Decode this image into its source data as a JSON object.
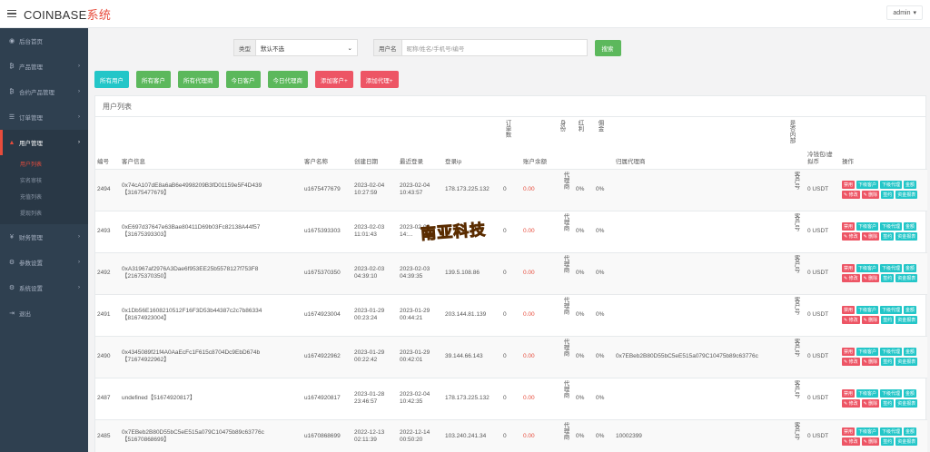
{
  "header": {
    "brand": "COINBASE",
    "brand_suffix": "系统",
    "user": "admin"
  },
  "sidebar": {
    "items": [
      {
        "label": "后台首页",
        "icon": "dashboard-icon",
        "arrow": false
      },
      {
        "label": "产品管理",
        "icon": "bitcoin-icon",
        "arrow": true
      },
      {
        "label": "合约产品管理",
        "icon": "bitcoin-icon",
        "arrow": true
      },
      {
        "label": "订单管理",
        "icon": "list-icon",
        "arrow": true
      },
      {
        "label": "用户管理",
        "icon": "user-icon",
        "arrow": true,
        "active": true
      },
      {
        "label": "财务管理",
        "icon": "yen-icon",
        "arrow": true
      },
      {
        "label": "参数设置",
        "icon": "gear-icon",
        "arrow": true
      },
      {
        "label": "系统设置",
        "icon": "gears-icon",
        "arrow": true
      },
      {
        "label": "退出",
        "icon": "logout-icon",
        "arrow": false
      }
    ],
    "subitems": [
      "用户列表",
      "实名审核",
      "充值列表",
      "提现列表"
    ]
  },
  "filter": {
    "type_label": "类型",
    "type_value": "默认不选",
    "user_label": "用户名",
    "user_placeholder": "昵称/姓名/手机号/编号",
    "search_label": "搜索"
  },
  "quick_buttons": [
    {
      "label": "所有用户",
      "color": "cyan"
    },
    {
      "label": "所有客户",
      "color": "green"
    },
    {
      "label": "所有代理商",
      "color": "green"
    },
    {
      "label": "今日客户",
      "color": "green"
    },
    {
      "label": "今日代理商",
      "color": "green"
    },
    {
      "label": "添加客户+",
      "color": "red"
    },
    {
      "label": "添加代理+",
      "color": "red"
    }
  ],
  "panel": {
    "title": "用户列表"
  },
  "table": {
    "headers": [
      "编号",
      "客户信息",
      "客户名称",
      "创建日期",
      "最近登录",
      "登录ip",
      "订单数",
      "账户余额",
      "身份",
      "红利",
      "佣金",
      "归属代理商",
      "是否内部",
      "冷钱包/虚拟币",
      "操作"
    ],
    "rows": [
      {
        "id": "2494",
        "info1": "0x74cA107dE8a6aB6e4998209B3fD01159e5F4D439",
        "info2": "【31675477679】",
        "name": "u1675477679",
        "created1": "2023-02-04",
        "created2": "10:27:59",
        "login1": "2023-02-04",
        "login2": "10:43:57",
        "ip": "178.173.225.132",
        "orders": "0",
        "balance": "0.00",
        "role": "代理商",
        "bonus": "0%",
        "commission": "0%",
        "agent": "",
        "internal": "客户号",
        "wallet": "0 USDT"
      },
      {
        "id": "2493",
        "info1": "0xE697d37647e63Bae80411D69b03Fc82138A44f57",
        "info2": "【31675393303】",
        "name": "u1675393303",
        "created1": "2023-02-03",
        "created2": "11:01:43",
        "login1": "2023-02-03",
        "login2": "14:...",
        "ip": "",
        "orders": "0",
        "balance": "0.00",
        "role": "代理商",
        "bonus": "0%",
        "commission": "0%",
        "agent": "",
        "internal": "客户号",
        "wallet": "0 USDT"
      },
      {
        "id": "2492",
        "info1": "0xA31967af2976A3Dae6f953EE25b5578127f753F8",
        "info2": "【21675370350】",
        "name": "u1675370350",
        "created1": "2023-02-03",
        "created2": "04:39:10",
        "login1": "2023-02-03",
        "login2": "04:39:35",
        "ip": "139.5.108.86",
        "orders": "0",
        "balance": "0.00",
        "role": "代理商",
        "bonus": "0%",
        "commission": "0%",
        "agent": "",
        "internal": "客户号",
        "wallet": "0 USDT"
      },
      {
        "id": "2491",
        "info1": "0x1Db56E1608210512F16F3D53b44387c2c7b86334",
        "info2": "【81674923004】",
        "name": "u1674923004",
        "created1": "2023-01-29",
        "created2": "00:23:24",
        "login1": "2023-01-29",
        "login2": "00:44:21",
        "ip": "203.144.81.139",
        "orders": "0",
        "balance": "0.00",
        "role": "代理商",
        "bonus": "0%",
        "commission": "0%",
        "agent": "",
        "internal": "客户号",
        "wallet": "0 USDT"
      },
      {
        "id": "2490",
        "info1": "0x4345089f21f4A0AaEcFc1F615c8704Dc9EbD674b",
        "info2": "【71674922962】",
        "name": "u1674922962",
        "created1": "2023-01-29",
        "created2": "00:22:42",
        "login1": "2023-01-29",
        "login2": "00:42:01",
        "ip": "39.144.66.143",
        "orders": "0",
        "balance": "0.00",
        "role": "代理商",
        "bonus": "0%",
        "commission": "0%",
        "agent": "0x7EBeb2B80D55bC5eE515a079C10475b89c63776c",
        "internal": "客户号",
        "wallet": "0 USDT"
      },
      {
        "id": "2487",
        "info1": "undefined【51674920817】",
        "info2": "",
        "name": "u1674920817",
        "created1": "2023-01-28",
        "created2": "23:46:57",
        "login1": "2023-02-04",
        "login2": "10:42:35",
        "ip": "178.173.225.132",
        "orders": "0",
        "balance": "0.00",
        "role": "代理商",
        "bonus": "0%",
        "commission": "0%",
        "agent": "",
        "internal": "客户号",
        "wallet": "0 USDT"
      },
      {
        "id": "2485",
        "info1": "0x7EBeb2B80D55bC5eE515a079C10475b89c63776c",
        "info2": "【51670868699】",
        "name": "u1670868699",
        "created1": "2022-12-13",
        "created2": "02:11:39",
        "login1": "2022-12-14",
        "login2": "00:50:20",
        "ip": "103.240.241.34",
        "orders": "0",
        "balance": "0.00",
        "role": "代理商",
        "bonus": "0%",
        "commission": "0%",
        "agent": "10002399",
        "internal": "客户号",
        "wallet": "0 USDT"
      }
    ],
    "ops": [
      {
        "label": "禁用",
        "color": "r"
      },
      {
        "label": "下级客户",
        "color": "c"
      },
      {
        "label": "下级代理",
        "color": "c"
      },
      {
        "label": "金额",
        "color": "c"
      },
      {
        "label": "✎ 修改",
        "color": "r"
      },
      {
        "label": "✎ 删除",
        "color": "r"
      },
      {
        "label": "签约",
        "color": "c"
      },
      {
        "label": "资金报表",
        "color": "c"
      }
    ]
  },
  "watermark": "南亚科技"
}
